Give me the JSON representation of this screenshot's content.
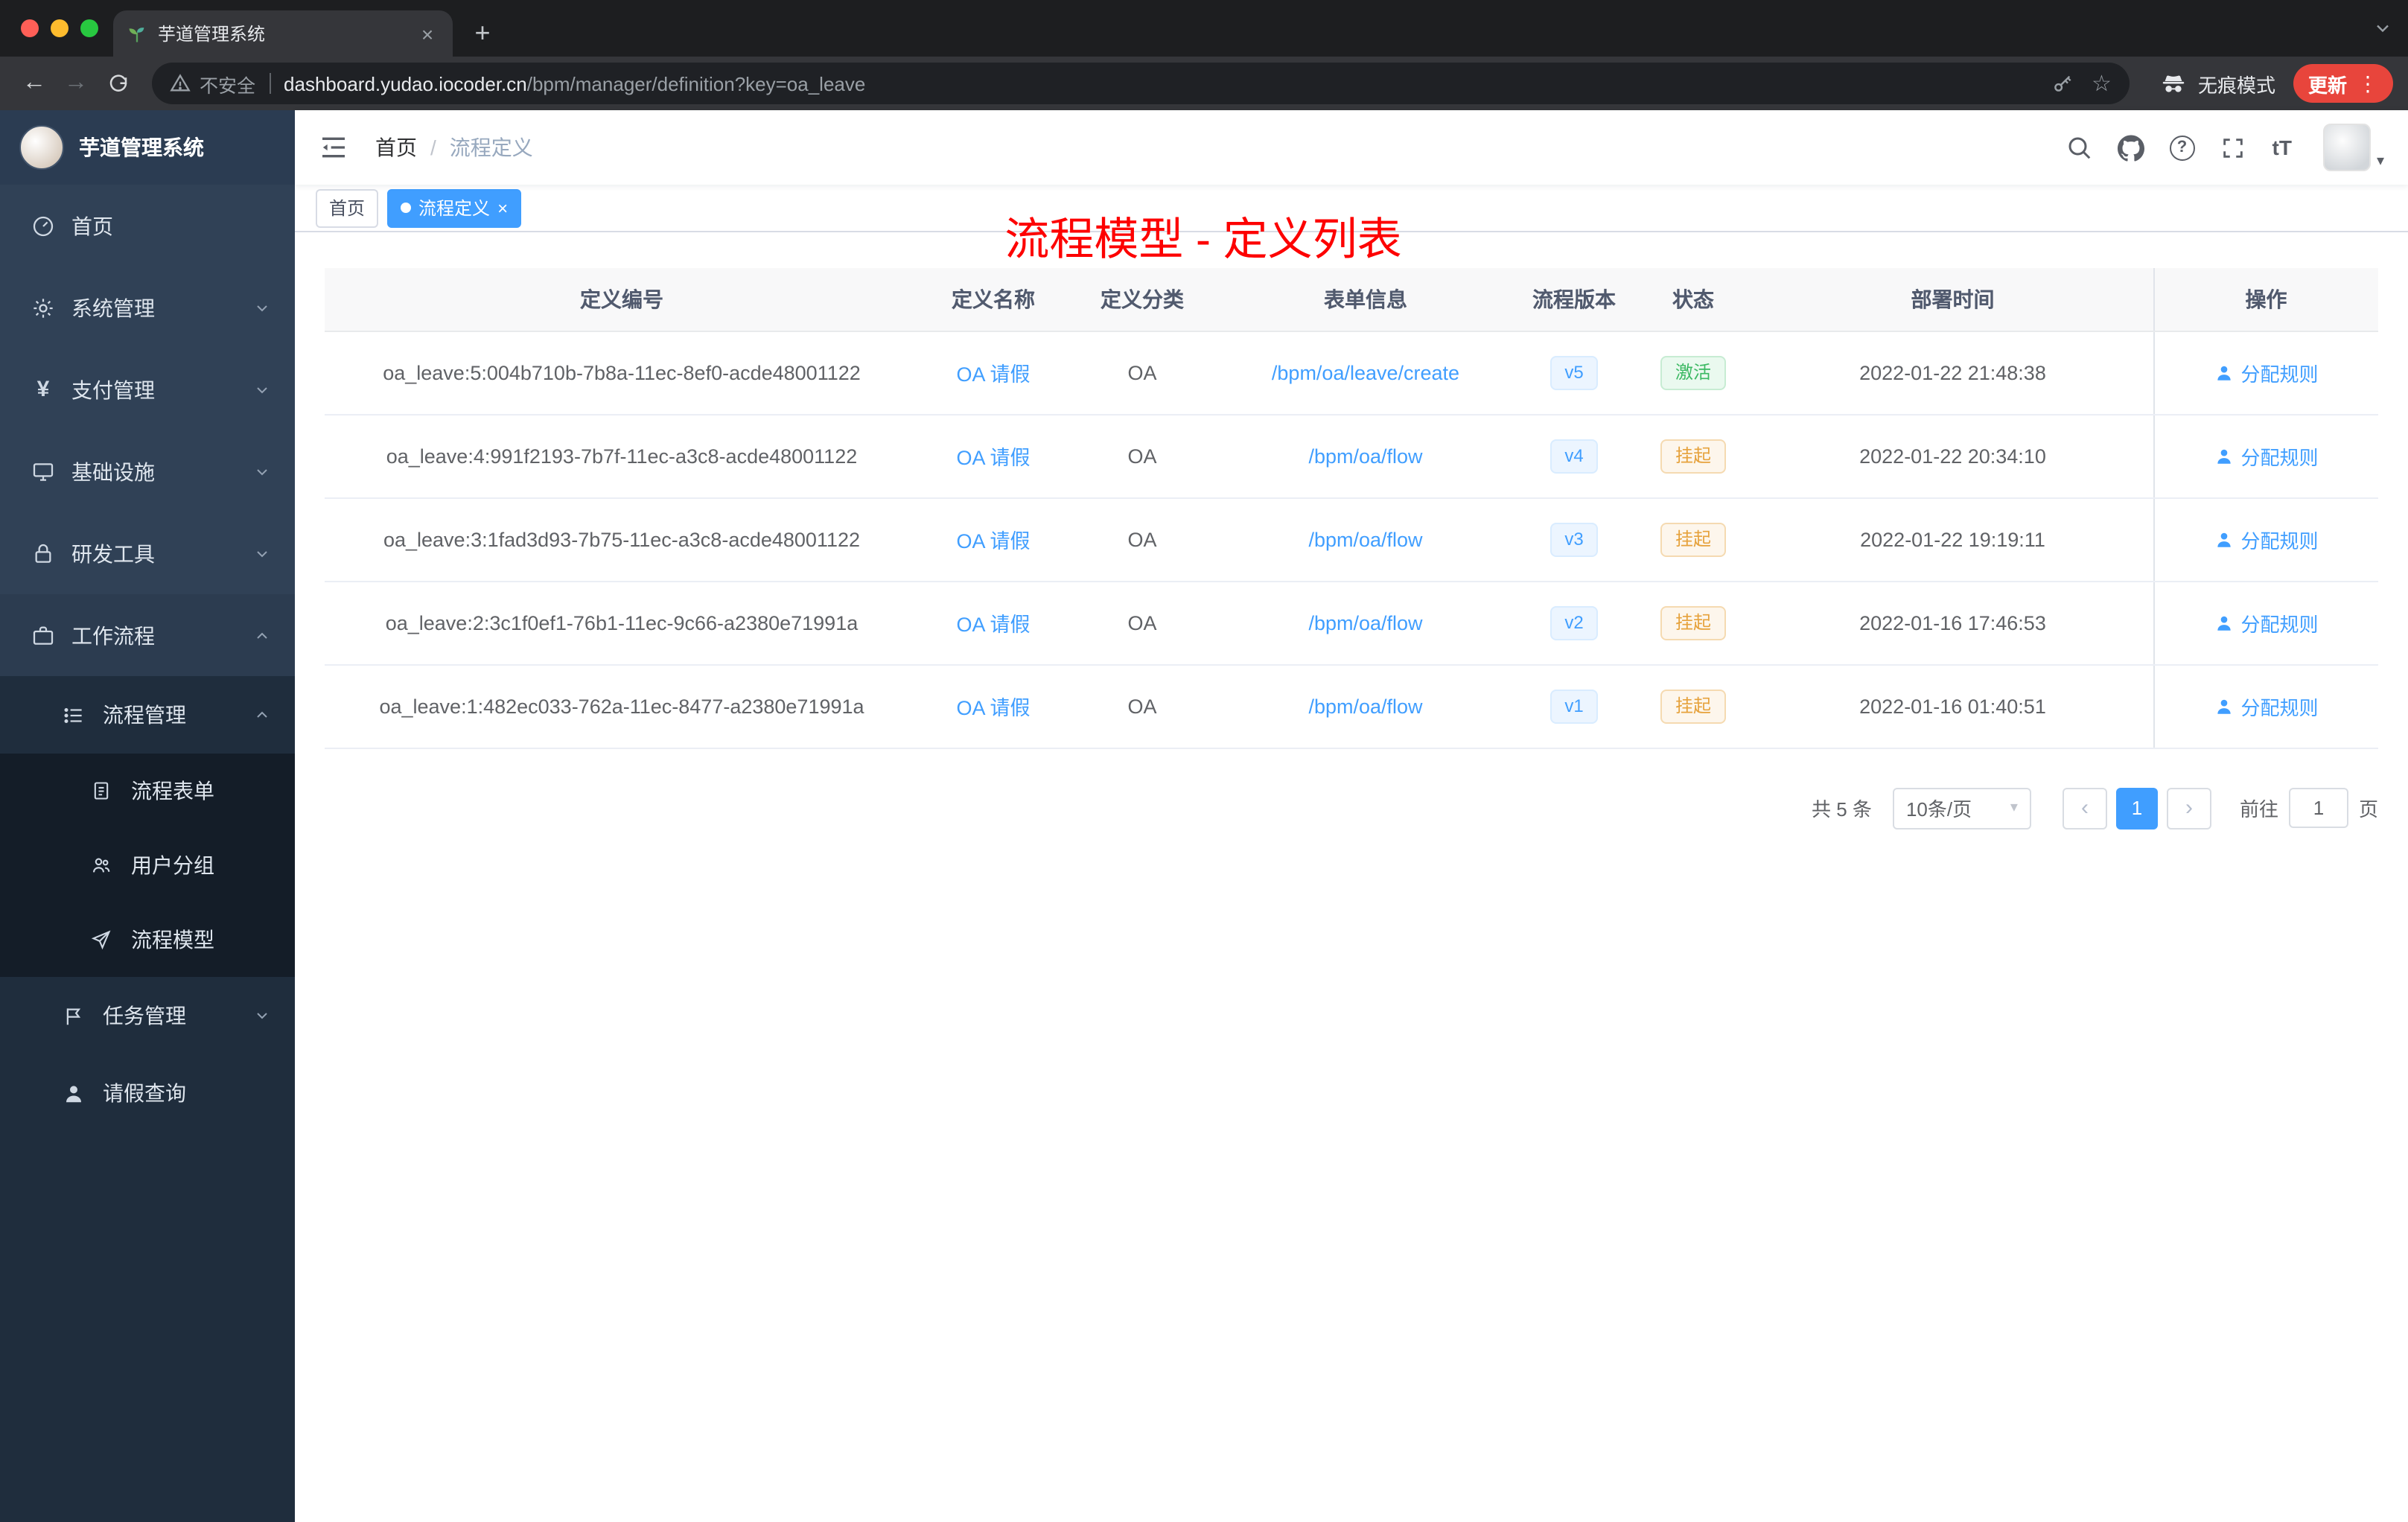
{
  "colors": {
    "accent_blue": "#409eff",
    "title_red": "#fd0000",
    "status_active_green": "#3cb963",
    "status_suspend_orange": "#e6a23c",
    "sidebar_bg": "#304156",
    "update_pill_red": "#e8453c"
  },
  "icons": {
    "back": "←",
    "forward": "→",
    "plus": "+",
    "close": "×",
    "star": "☆",
    "kebab": "⋮",
    "yen": "¥",
    "question": "?",
    "fontsize": "tT",
    "caret_down": "▾",
    "prev": "‹",
    "next": "›",
    "crumb_sep": "/"
  },
  "chrome": {
    "tab_title": "芋道管理系统",
    "security_label": "不安全",
    "url_host": "dashboard.yudao.iocoder.cn",
    "url_path": "/bpm/manager/definition?key=oa_leave",
    "incognito_label": "无痕模式",
    "update_label": "更新"
  },
  "sidebar": {
    "logo_title": "芋道管理系统",
    "items": [
      {
        "label": "首页"
      },
      {
        "label": "系统管理"
      },
      {
        "label": "支付管理"
      },
      {
        "label": "基础设施"
      },
      {
        "label": "研发工具"
      },
      {
        "label": "工作流程"
      }
    ],
    "workflow": {
      "process_management": {
        "label": "流程管理"
      },
      "process_children": [
        {
          "label": "流程表单"
        },
        {
          "label": "用户分组"
        },
        {
          "label": "流程模型"
        }
      ],
      "task_management": {
        "label": "任务管理"
      },
      "leave_query": {
        "label": "请假查询"
      }
    }
  },
  "navbar": {
    "breadcrumb_home": "首页",
    "breadcrumb_current": "流程定义",
    "title": "流程模型 - 定义列表"
  },
  "tags": [
    {
      "label": "首页",
      "active": false
    },
    {
      "label": "流程定义",
      "active": true
    }
  ],
  "table": {
    "columns": [
      "定义编号",
      "定义名称",
      "定义分类",
      "表单信息",
      "流程版本",
      "状态",
      "部署时间",
      "操作"
    ],
    "rows": [
      {
        "id": "oa_leave:5:004b710b-7b8a-11ec-8ef0-acde48001122",
        "name": "OA 请假",
        "category": "OA",
        "form": "/bpm/oa/leave/create",
        "version": "v5",
        "status": "激活",
        "status_type": "success",
        "deployed_at": "2022-01-22 21:48:38",
        "action": "分配规则"
      },
      {
        "id": "oa_leave:4:991f2193-7b7f-11ec-a3c8-acde48001122",
        "name": "OA 请假",
        "category": "OA",
        "form": "/bpm/oa/flow",
        "version": "v4",
        "status": "挂起",
        "status_type": "warning",
        "deployed_at": "2022-01-22 20:34:10",
        "action": "分配规则"
      },
      {
        "id": "oa_leave:3:1fad3d93-7b75-11ec-a3c8-acde48001122",
        "name": "OA 请假",
        "category": "OA",
        "form": "/bpm/oa/flow",
        "version": "v3",
        "status": "挂起",
        "status_type": "warning",
        "deployed_at": "2022-01-22 19:19:11",
        "action": "分配规则"
      },
      {
        "id": "oa_leave:2:3c1f0ef1-76b1-11ec-9c66-a2380e71991a",
        "name": "OA 请假",
        "category": "OA",
        "form": "/bpm/oa/flow",
        "version": "v2",
        "status": "挂起",
        "status_type": "warning",
        "deployed_at": "2022-01-16 17:46:53",
        "action": "分配规则"
      },
      {
        "id": "oa_leave:1:482ec033-762a-11ec-8477-a2380e71991a",
        "name": "OA 请假",
        "category": "OA",
        "form": "/bpm/oa/flow",
        "version": "v1",
        "status": "挂起",
        "status_type": "warning",
        "deployed_at": "2022-01-16 01:40:51",
        "action": "分配规则"
      }
    ]
  },
  "pagination": {
    "total_label": "共 5 条",
    "page_size": "10条/页",
    "current_page": "1",
    "goto_label": "前往",
    "goto_value": "1",
    "page_suffix": "页"
  }
}
